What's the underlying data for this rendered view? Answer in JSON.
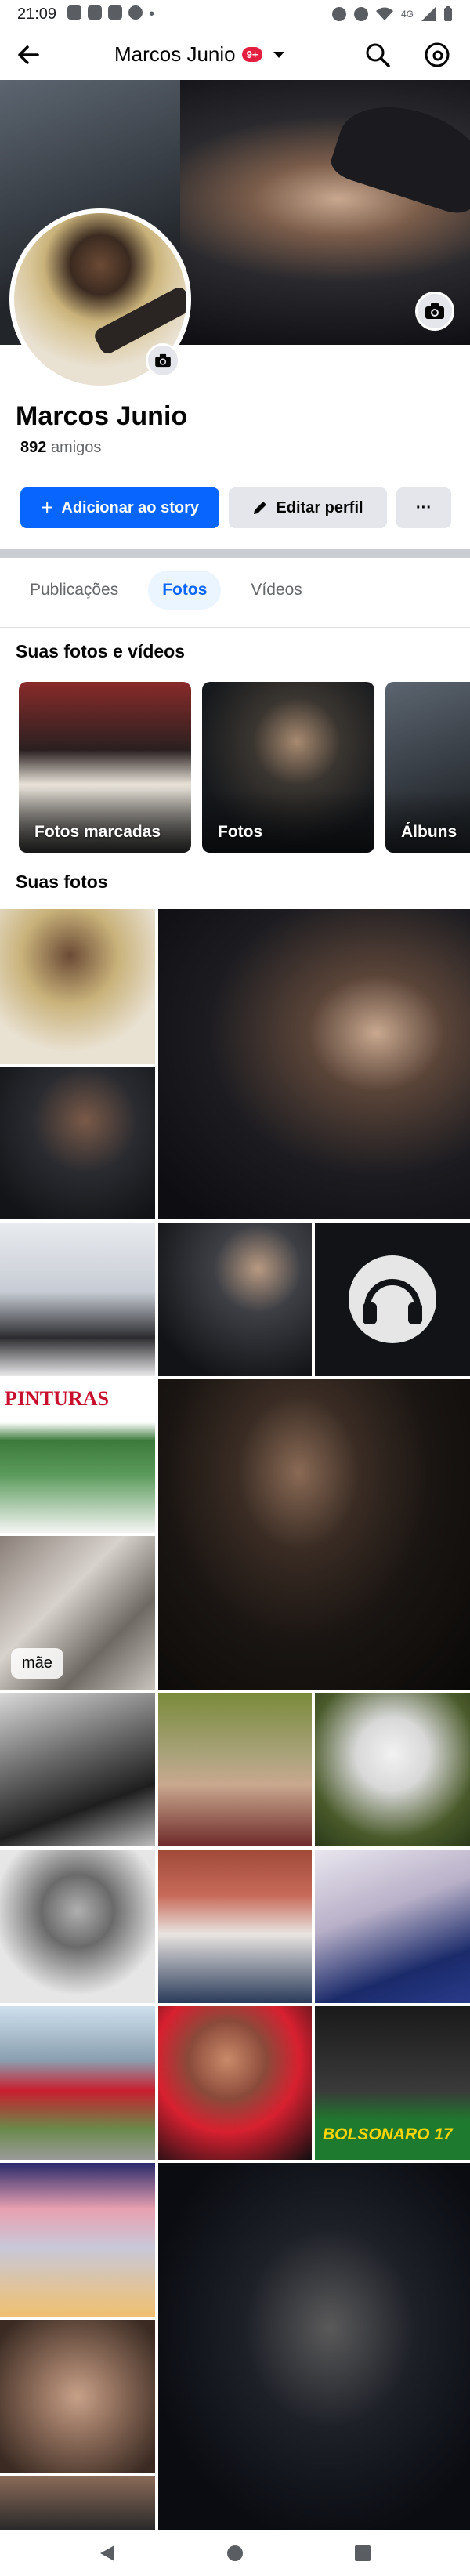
{
  "status_bar": {
    "time": "21:09",
    "network": "4G"
  },
  "header": {
    "title": "Marcos Junio",
    "badge": "9+"
  },
  "profile": {
    "name": "Marcos Junio",
    "friends_count": "892",
    "friends_label": "amigos"
  },
  "actions": {
    "add_story": "Adicionar ao story",
    "edit_profile": "Editar perfil",
    "more": "···"
  },
  "tabs": [
    {
      "label": "Publicações",
      "active": false
    },
    {
      "label": "Fotos",
      "active": true
    },
    {
      "label": "Vídeos",
      "active": false
    }
  ],
  "sections": {
    "photos_and_videos": "Suas fotos e vídeos",
    "your_photos": "Suas fotos"
  },
  "albums": [
    {
      "label": "Fotos marcadas"
    },
    {
      "label": "Fotos"
    },
    {
      "label": "Álbuns"
    }
  ],
  "photo_tags": {
    "mae": "mãe"
  },
  "photo_texts": {
    "pinturas": "PINTURAS",
    "bolsonaro": "BOLSONARO 17"
  },
  "colors": {
    "primary": "#0866ff",
    "badge": "#e41e3f",
    "secondary_button": "#e4e6eb",
    "tab_active_bg": "#ebf5ff"
  },
  "icons": {
    "back": "arrow-left",
    "search": "magnifier",
    "threads": "threads-logo",
    "camera": "camera",
    "edit": "pencil"
  }
}
